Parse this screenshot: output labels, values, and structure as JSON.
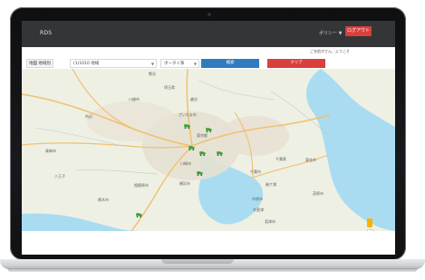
{
  "app": {
    "title": "RDS"
  },
  "header": {
    "menu_label": "ポリシー ▼",
    "logout_label": "ログアウト",
    "welcome": "ご名前がさん、ようこそ"
  },
  "controls": {
    "label": "地図 地域別",
    "region_select": "(1)1010 地域",
    "type_select": "ボータイ系",
    "search_label": "検索",
    "clear_label": "クリア"
  },
  "map": {
    "place_labels": [
      "熊谷",
      "越谷",
      "所沢",
      "川越市",
      "さいたま市",
      "埼玉県",
      "東京都",
      "川崎市",
      "横浜市",
      "千葉県",
      "千葉市",
      "市原市",
      "茂原市",
      "相模原市",
      "厚木市",
      "木更津",
      "君津市",
      "東金市",
      "八王子",
      "青梅市",
      "袖ケ浦"
    ],
    "colors": {
      "land": "#eef0e4",
      "water": "#a9dcf0",
      "roads": "#f0c070",
      "markers": "#3ca33a"
    },
    "marker_icons": [
      "truck-marker-icon"
    ]
  },
  "device": {
    "frame": "laptop"
  }
}
